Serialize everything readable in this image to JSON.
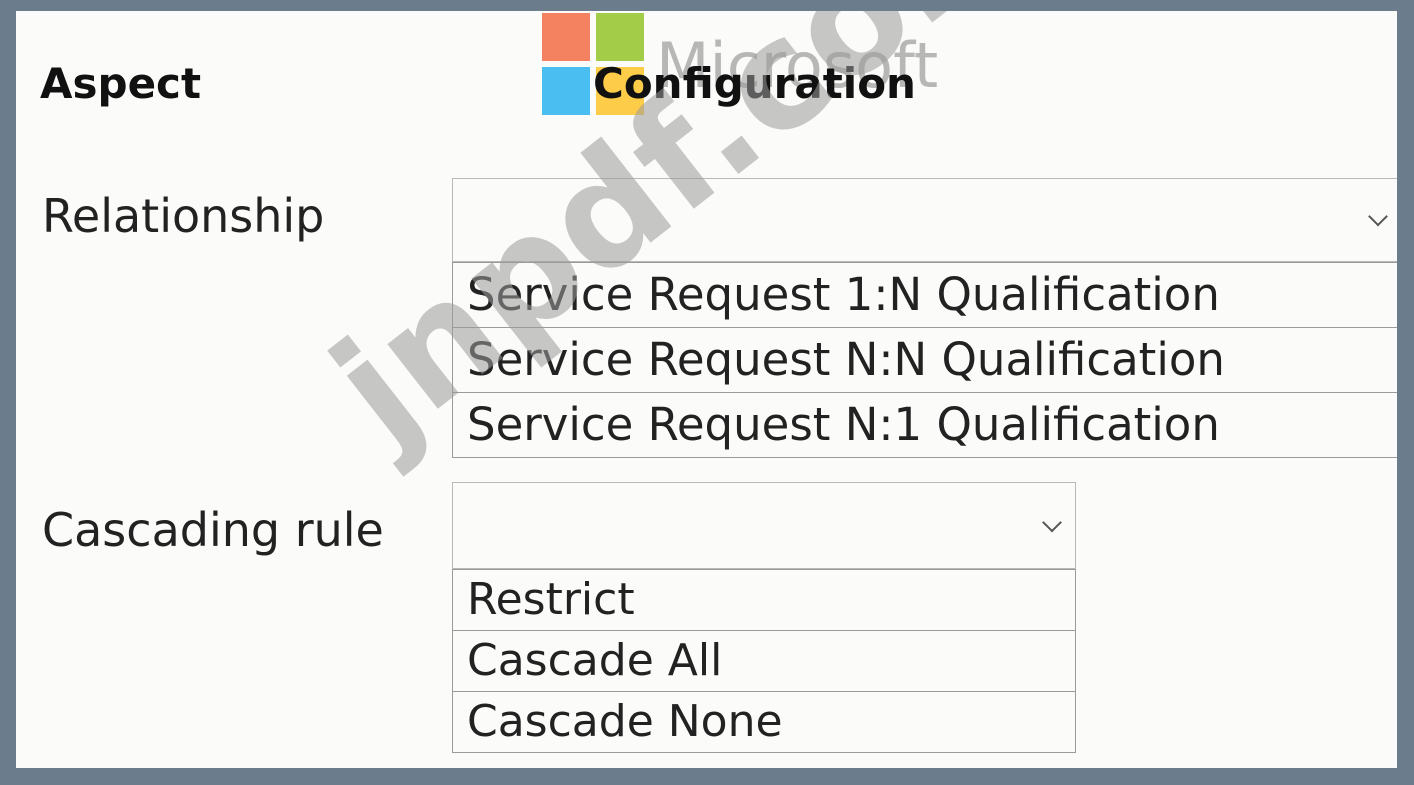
{
  "logo": {
    "name": "microsoft-logo",
    "wordmark": "Microsoft",
    "colors": [
      "#f25022",
      "#7fba00",
      "#00a4ef",
      "#ffb900"
    ]
  },
  "watermark": {
    "text": "jnpdf.com"
  },
  "headers": {
    "aspect": "Aspect",
    "configuration": "Configuration"
  },
  "rows": {
    "relationship": {
      "label": "Relationship",
      "selected": "",
      "options": [
        "Service Request 1:N Qualification",
        "Service Request N:N Qualification",
        "Service Request N:1 Qualification"
      ]
    },
    "cascading": {
      "label": "Cascading rule",
      "selected": "",
      "options": [
        "Restrict",
        "Cascade All",
        "Cascade None"
      ]
    }
  },
  "icons": {
    "dropdown": "chevron-down-icon"
  }
}
